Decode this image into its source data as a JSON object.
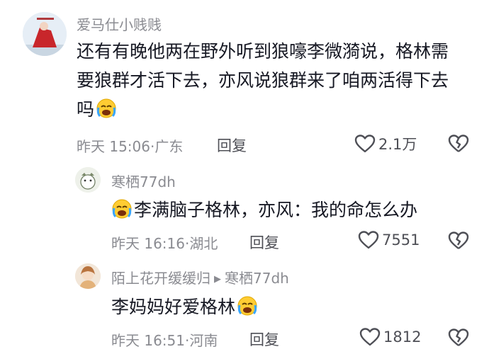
{
  "comments": [
    {
      "username": "爱马仕小贱贱",
      "text": "还有有晚他两在野外听到狼嚎李微漪说，格林需要狼群才活下去，亦风说狼群来了咱两活得下去吗",
      "emoji": "crying-emoji",
      "time": "昨天 15:06",
      "location": "广东",
      "reply_label": "回复",
      "likes": "2.1万"
    },
    {
      "username": "寒栖77dh",
      "text": "李满脑子格林，亦风：我的命怎么办",
      "emoji": "crying-emoji",
      "time": "昨天 16:16",
      "location": "湖北",
      "reply_label": "回复",
      "likes": "7551"
    },
    {
      "username": "陌上花开缓缓归",
      "reply_to": "寒栖77dh",
      "text": "李妈妈好爱格林",
      "emoji": "crying-emoji",
      "time": "昨天 16:51",
      "location": "河南",
      "reply_label": "回复",
      "likes": "1812"
    }
  ],
  "colors": {
    "text": "#161823",
    "meta": "#8a8b91",
    "action": "#4e4f56"
  }
}
